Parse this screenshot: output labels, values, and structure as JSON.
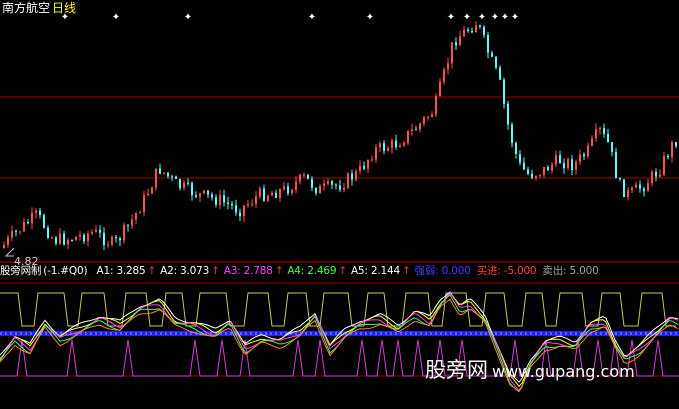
{
  "header": {
    "stock_name": "南方航空",
    "period": "日线"
  },
  "price_pane": {
    "low_label": "4.82",
    "marker_glyph": "✦"
  },
  "indicator": {
    "name": "股旁网制",
    "params": "(-1.#Q0)",
    "values": [
      {
        "label": "A1:",
        "value": "3.285",
        "color": "#ffffff"
      },
      {
        "label": "A2:",
        "value": "3.073",
        "color": "#ffffff"
      },
      {
        "label": "A3:",
        "value": "2.788",
        "color": "#ff44ff"
      },
      {
        "label": "A4:",
        "value": "2.469",
        "color": "#44ff44"
      },
      {
        "label": "A5:",
        "value": "2.144",
        "color": "#ffffff"
      }
    ],
    "up_arrow": "↑",
    "signals": [
      {
        "label": "强弱:",
        "value": "0.000",
        "color": "#4040ff"
      },
      {
        "label": "买进:",
        "value": "-5.000",
        "color": "#ff4040"
      },
      {
        "label": "卖出:",
        "value": "5.000",
        "color": "#a0a0a0"
      }
    ]
  },
  "watermark": {
    "text": "股旁网",
    "url": "www.gupang.com"
  },
  "colors": {
    "background": "#000000",
    "up_candle": "#ff5050",
    "down_candle": "#54ffff",
    "gridline": "#a00000",
    "upper_band": "#c8c864",
    "buy_signal": "#d040d0",
    "zero_line": "#2020ff"
  }
}
